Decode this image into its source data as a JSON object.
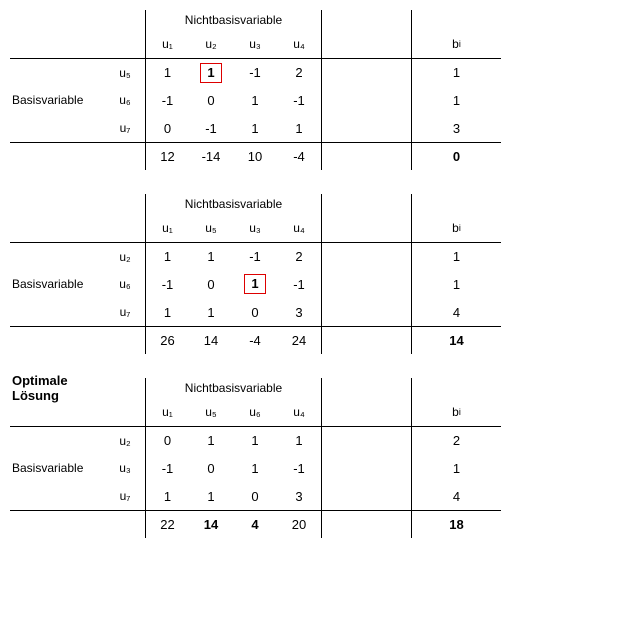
{
  "labels": {
    "nbv": "Nichtbasisvariable",
    "bv": "Basisvariable",
    "optimal": "Optimale Lösung",
    "b": "b"
  },
  "tableaux": [
    {
      "heading": "",
      "nbv": [
        "u₁",
        "u₂",
        "u₃",
        "u₄"
      ],
      "basis": [
        "u₅",
        "u₆",
        "u₇"
      ],
      "rows": [
        [
          "1",
          "1",
          "-1",
          "2",
          "1"
        ],
        [
          "-1",
          "0",
          "1",
          "-1",
          "1"
        ],
        [
          "0",
          "-1",
          "1",
          "1",
          "3"
        ]
      ],
      "zrow": [
        "12",
        "-14",
        "10",
        "-4",
        "0"
      ],
      "pivot": [
        0,
        1
      ]
    },
    {
      "heading": "",
      "nbv": [
        "u₁",
        "u₅",
        "u₃",
        "u₄"
      ],
      "basis": [
        "u₂",
        "u₆",
        "u₇"
      ],
      "rows": [
        [
          "1",
          "1",
          "-1",
          "2",
          "1"
        ],
        [
          "-1",
          "0",
          "1",
          "-1",
          "1"
        ],
        [
          "1",
          "1",
          "0",
          "3",
          "4"
        ]
      ],
      "zrow": [
        "26",
        "14",
        "-4",
        "24",
        "14"
      ],
      "pivot": [
        1,
        2
      ]
    },
    {
      "heading": "optimal",
      "nbv": [
        "u₁",
        "u₅",
        "u₆",
        "u₄"
      ],
      "basis": [
        "u₂",
        "u₃",
        "u₇"
      ],
      "rows": [
        [
          "0",
          "1",
          "1",
          "1",
          "2"
        ],
        [
          "-1",
          "0",
          "1",
          "-1",
          "1"
        ],
        [
          "1",
          "1",
          "0",
          "3",
          "4"
        ]
      ],
      "zrow": [
        "22",
        "14",
        "4",
        "20",
        "18"
      ],
      "zbold": [
        1,
        2,
        4
      ],
      "pivot": null
    }
  ],
  "chart_data": [
    {
      "type": "table",
      "title": "Simplex Tableau 1",
      "nonbasic_vars": [
        "u1",
        "u2",
        "u3",
        "u4"
      ],
      "basic_vars": [
        "u5",
        "u6",
        "u7"
      ],
      "matrix": [
        [
          1,
          1,
          -1,
          2
        ],
        [
          -1,
          0,
          1,
          -1
        ],
        [
          0,
          -1,
          1,
          1
        ]
      ],
      "b": [
        1,
        1,
        3
      ],
      "objective_row": [
        12,
        -14,
        10,
        -4
      ],
      "objective_value": 0,
      "pivot": {
        "row": "u5",
        "col": "u2",
        "value": 1
      }
    },
    {
      "type": "table",
      "title": "Simplex Tableau 2",
      "nonbasic_vars": [
        "u1",
        "u5",
        "u3",
        "u4"
      ],
      "basic_vars": [
        "u2",
        "u6",
        "u7"
      ],
      "matrix": [
        [
          1,
          1,
          -1,
          2
        ],
        [
          -1,
          0,
          1,
          -1
        ],
        [
          1,
          1,
          0,
          3
        ]
      ],
      "b": [
        1,
        1,
        4
      ],
      "objective_row": [
        26,
        14,
        -4,
        24
      ],
      "objective_value": 14,
      "pivot": {
        "row": "u6",
        "col": "u3",
        "value": 1
      }
    },
    {
      "type": "table",
      "title": "Simplex Tableau 3 — Optimale Lösung",
      "nonbasic_vars": [
        "u1",
        "u5",
        "u6",
        "u4"
      ],
      "basic_vars": [
        "u2",
        "u3",
        "u7"
      ],
      "matrix": [
        [
          0,
          1,
          1,
          1
        ],
        [
          -1,
          0,
          1,
          -1
        ],
        [
          1,
          1,
          0,
          3
        ]
      ],
      "b": [
        2,
        1,
        4
      ],
      "objective_row": [
        22,
        14,
        4,
        20
      ],
      "objective_value": 18,
      "pivot": null
    }
  ]
}
